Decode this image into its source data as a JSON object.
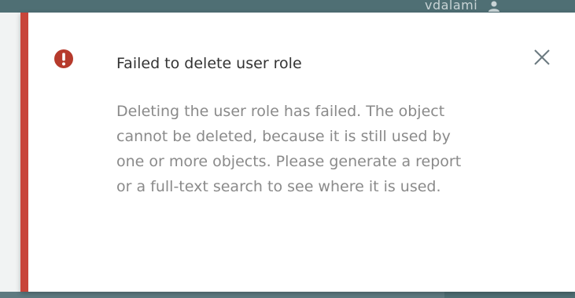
{
  "background": {
    "username_partial": "vdalami",
    "user_icon": "user-icon"
  },
  "toast": {
    "type": "error",
    "icon": "error-circle-icon",
    "title": "Failed to delete user role",
    "message": "Deleting the user role has failed. The object\ncannot be deleted, because it is still used by\none or more objects. Please generate a report\nor a full-text search to see where it is used.",
    "close_icon": "close-icon",
    "accent_color": "#c8453a",
    "icon_color": "#b63a2c"
  }
}
